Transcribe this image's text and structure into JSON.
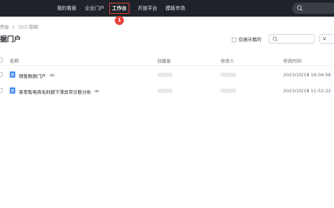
{
  "nav": {
    "items": [
      {
        "label": "我的看板"
      },
      {
        "label": "企业门户"
      },
      {
        "label": "工作台",
        "active": true
      },
      {
        "label": "开放平台"
      },
      {
        "label": "模板市场"
      }
    ],
    "step_marker": "1"
  },
  "breadcrumb": {
    "root": "作台",
    "separator": "/",
    "current_suffix": "空间"
  },
  "page": {
    "title": "据门户"
  },
  "toolbar": {
    "only_mine_label": "仅展示我的",
    "filter_label": "V"
  },
  "table": {
    "columns": [
      "名称",
      "创建者",
      "修改人",
      "修改时间"
    ],
    "rows": [
      {
        "name": "销售数据门户",
        "modified_time": "2023/10/18 16:04:56"
      },
      {
        "name": "某零售电商毛利额下滑异常诊断分析",
        "modified_time": "2023/10/18 11:52:22"
      }
    ]
  },
  "colors": {
    "topbar": "#1f2329",
    "highlight": "#e5413b",
    "doc_icon": "#4b8ff7"
  },
  "icons": [
    "search-icon",
    "eye-icon",
    "portal-doc-icon"
  ]
}
